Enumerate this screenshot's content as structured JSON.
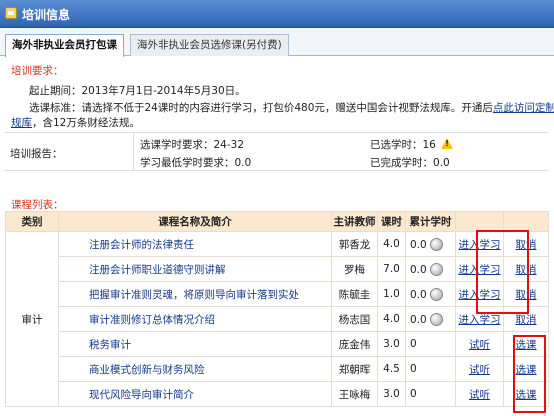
{
  "window": {
    "title": "培训信息"
  },
  "tabs": [
    {
      "label": "海外非执业会员打包课",
      "active": true
    },
    {
      "label": "海外非执业会员选修课(另付费)",
      "active": false
    }
  ],
  "requirements": {
    "heading": "培训要求：",
    "period": "起止期间：2013年7月1日-2014年5月30日。",
    "standard_text": "选课标准：请选择不低于24课时的内容进行学习，打包价480元，赠送中国会计视野法规库。开通后",
    "standard_link": "点此访问定制版法",
    "library_link": "规库",
    "library_suffix": "，含12万条财经法规。"
  },
  "report": {
    "label": "培训报告：",
    "select_hours_req": "选课学时要求：24-32",
    "min_hours_req": "学习最低学时要求：0.0",
    "selected_hours": "已选学时：16",
    "completed_hours": "已完成学时：0.0"
  },
  "course_list": {
    "heading": "课程列表：",
    "columns": [
      "类别",
      "课程名称及简介",
      "主讲教师",
      "课时",
      "累计学时",
      "",
      ""
    ],
    "category": "审计",
    "rows": [
      {
        "name": "注册会计师的法律责任",
        "teacher": "郭香龙",
        "hours": "4.0",
        "cumulative": "0.0",
        "progress_icon": "progress-circle-icon",
        "action1": "进入学习",
        "action2": "取消"
      },
      {
        "name": "注册会计师职业道德守则讲解",
        "teacher": "罗梅",
        "hours": "7.0",
        "cumulative": "0.0",
        "progress_icon": "progress-circle-icon",
        "action1": "进入学习",
        "action2": "取消"
      },
      {
        "name": "把握审计准则灵魂，将原则导向审计落到实处",
        "teacher": "陈毓圭",
        "hours": "1.0",
        "cumulative": "0.0",
        "progress_icon": "progress-circle-icon",
        "action1": "进入学习",
        "action2": "取消"
      },
      {
        "name": "审计准则修订总体情况介绍",
        "teacher": "杨志国",
        "hours": "4.0",
        "cumulative": "0.0",
        "progress_icon": "progress-circle-icon",
        "action1": "进入学习",
        "action2": "取消"
      },
      {
        "name": "税务审计",
        "teacher": "庞金伟",
        "hours": "3.0",
        "cumulative": "0",
        "progress_icon": "",
        "action1": "试听",
        "action2": "选课"
      },
      {
        "name": "商业模式创新与财务风险",
        "teacher": "郑朝晖",
        "hours": "4.5",
        "cumulative": "0",
        "progress_icon": "",
        "action1": "试听",
        "action2": "选课"
      },
      {
        "name": "现代风险导向审计简介",
        "teacher": "王咏梅",
        "hours": "3.0",
        "cumulative": "0",
        "progress_icon": "",
        "action1": "试听",
        "action2": "选课"
      }
    ]
  },
  "colors": {
    "title_bar": "#2f64b3",
    "header_row": "#fbe8cf",
    "accent_red": "#d9361d",
    "highlight_box": "#e01010",
    "link": "#123a8a"
  },
  "icons": {
    "title_icon": "window-icon",
    "warning_icon": "warning-icon"
  }
}
